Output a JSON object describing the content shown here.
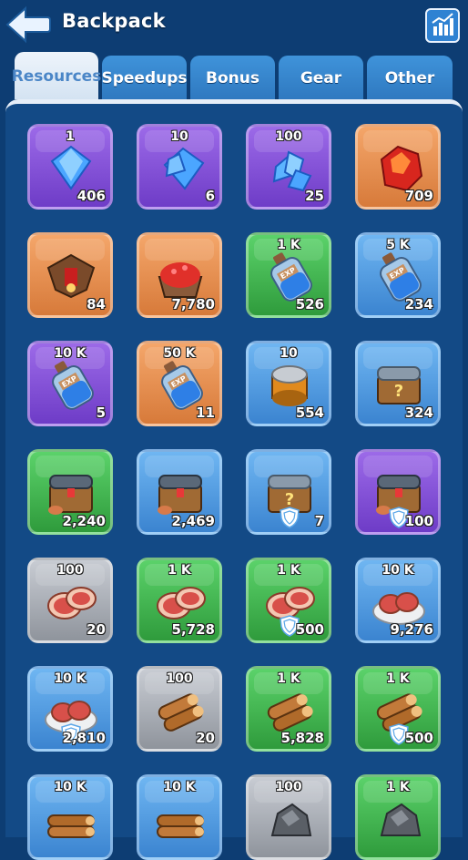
{
  "header": {
    "title": "Backpack"
  },
  "tabs": [
    {
      "label": "Resources",
      "active": true
    },
    {
      "label": "Speedups",
      "active": false
    },
    {
      "label": "Bonus",
      "active": false
    },
    {
      "label": "Gear",
      "active": false
    },
    {
      "label": "Other",
      "active": false
    }
  ],
  "items": [
    {
      "qty": "1",
      "count": "406",
      "rarity": "purple",
      "icon": "diamond-icon"
    },
    {
      "qty": "10",
      "count": "6",
      "rarity": "purple",
      "icon": "diamonds-icon"
    },
    {
      "qty": "100",
      "count": "25",
      "rarity": "purple",
      "icon": "diamond-pile-icon"
    },
    {
      "qty": "",
      "count": "709",
      "rarity": "orange",
      "icon": "red-crystal-icon"
    },
    {
      "qty": "",
      "count": "84",
      "rarity": "orange",
      "icon": "fire-altar-icon"
    },
    {
      "qty": "",
      "count": "7,780",
      "rarity": "orange",
      "icon": "ruby-ore-cart-icon"
    },
    {
      "qty": "1 K",
      "count": "526",
      "rarity": "green",
      "icon": "exp-potion-icon"
    },
    {
      "qty": "5 K",
      "count": "234",
      "rarity": "blue",
      "icon": "exp-potion-icon"
    },
    {
      "qty": "10 K",
      "count": "5",
      "rarity": "purple",
      "icon": "exp-potion-icon"
    },
    {
      "qty": "50 K",
      "count": "11",
      "rarity": "orange",
      "icon": "exp-potion-icon"
    },
    {
      "qty": "10",
      "count": "554",
      "rarity": "blue",
      "icon": "tin-can-icon"
    },
    {
      "qty": "",
      "count": "324",
      "rarity": "blue",
      "icon": "mystery-chest-icon"
    },
    {
      "qty": "",
      "count": "2,240",
      "rarity": "green",
      "icon": "resource-chest-icon"
    },
    {
      "qty": "",
      "count": "2,469",
      "rarity": "blue",
      "icon": "resource-chest-icon"
    },
    {
      "qty": "",
      "count": "7",
      "rarity": "blue",
      "icon": "mystery-chest-icon",
      "shield": true
    },
    {
      "qty": "",
      "count": "100",
      "rarity": "purple",
      "icon": "resource-chest-icon",
      "shield": true
    },
    {
      "qty": "100",
      "count": "20",
      "rarity": "gray",
      "icon": "meat-icon"
    },
    {
      "qty": "1 K",
      "count": "5,728",
      "rarity": "green",
      "icon": "meat-icon"
    },
    {
      "qty": "1 K",
      "count": "500",
      "rarity": "green",
      "icon": "meat-icon",
      "shield": true
    },
    {
      "qty": "10 K",
      "count": "9,276",
      "rarity": "blue",
      "icon": "meat-platter-icon"
    },
    {
      "qty": "10 K",
      "count": "2,810",
      "rarity": "blue",
      "icon": "meat-platter-icon",
      "shield": true
    },
    {
      "qty": "100",
      "count": "20",
      "rarity": "gray",
      "icon": "wood-icon"
    },
    {
      "qty": "1 K",
      "count": "5,828",
      "rarity": "green",
      "icon": "wood-icon"
    },
    {
      "qty": "1 K",
      "count": "500",
      "rarity": "green",
      "icon": "wood-icon",
      "shield": true
    },
    {
      "qty": "10 K",
      "count": "",
      "rarity": "blue",
      "icon": "wood-pile-icon"
    },
    {
      "qty": "10 K",
      "count": "",
      "rarity": "blue",
      "icon": "wood-pile-icon"
    },
    {
      "qty": "100",
      "count": "",
      "rarity": "gray",
      "icon": "stone-icon"
    },
    {
      "qty": "1 K",
      "count": "",
      "rarity": "green",
      "icon": "stone-icon"
    }
  ],
  "colors": {
    "background": "#0d3d73",
    "panel": "#134a86",
    "rarity_purple": "#7f4fd6",
    "rarity_orange": "#e38d4e",
    "rarity_green": "#3db14c",
    "rarity_blue": "#4d96de",
    "rarity_gray": "#a9adb4"
  }
}
